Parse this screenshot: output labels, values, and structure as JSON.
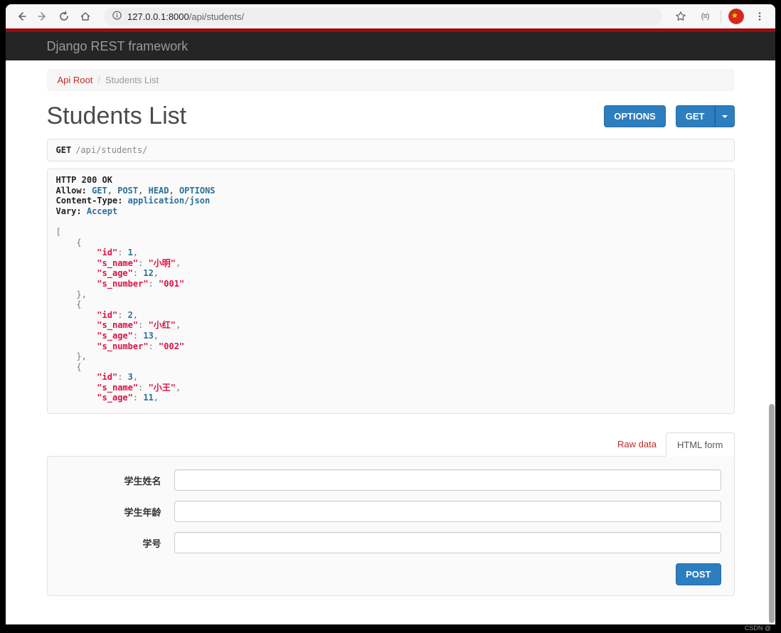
{
  "colors": {
    "accent_blue": "#2d7ebf",
    "link_red": "#c02b2b",
    "code_string_red": "#dd1144",
    "code_number_blue": "#2a6f9b",
    "navbar_bg": "#252525",
    "loading_bar_red": "#9e0b0f"
  },
  "browser": {
    "url_host": "127.0.0.1:8000",
    "url_path": "/api/students/",
    "extension_glyph": "(≡)"
  },
  "navbar": {
    "brand": "Django REST framework"
  },
  "breadcrumb": {
    "root": "Api Root",
    "separator": "/",
    "current": "Students List"
  },
  "header": {
    "title": "Students List",
    "options_label": "OPTIONS",
    "get_label": "GET"
  },
  "request": {
    "method": "GET",
    "path": "/api/students/"
  },
  "response": {
    "status_line": "HTTP 200 OK",
    "headers": [
      {
        "name": "Allow",
        "values": [
          "GET",
          "POST",
          "HEAD",
          "OPTIONS"
        ]
      },
      {
        "name": "Content-Type",
        "values": [
          "application/json"
        ]
      },
      {
        "name": "Vary",
        "values": [
          "Accept"
        ]
      }
    ],
    "truncated": true,
    "students": [
      {
        "id": 1,
        "s_name": "小明",
        "s_age": 12,
        "s_number": "001"
      },
      {
        "id": 2,
        "s_name": "小红",
        "s_age": 13,
        "s_number": "002"
      },
      {
        "id": 3,
        "s_name": "小王",
        "s_age": 11
      }
    ]
  },
  "tabs": {
    "raw_data": "Raw data",
    "html_form": "HTML form"
  },
  "form": {
    "fields": [
      {
        "label": "学生姓名",
        "value": "",
        "placeholder": ""
      },
      {
        "label": "学生年龄",
        "value": "",
        "placeholder": ""
      },
      {
        "label": "学号",
        "value": "",
        "placeholder": ""
      }
    ],
    "submit_label": "POST"
  },
  "watermark": "CSDN @"
}
